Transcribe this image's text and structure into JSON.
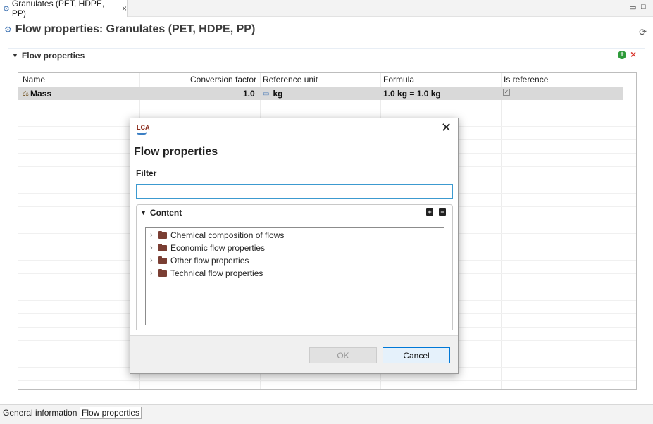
{
  "editor_tab": {
    "icon": "gear-icon",
    "label": "Granulates (PET, HDPE, PP)",
    "close": "×"
  },
  "window_controls": {
    "minimize": "▭",
    "maximize": "□"
  },
  "form": {
    "title": "Flow properties: Granulates (PET, HDPE, PP)",
    "refresh_icon": "⟳"
  },
  "section": {
    "title": "Flow properties",
    "add_icon": "+",
    "remove_icon": "×"
  },
  "table": {
    "columns": [
      "Name",
      "Conversion factor",
      "Reference unit",
      "Formula",
      "Is reference"
    ],
    "rows": [
      {
        "name": "Mass",
        "conversion_factor": "1.0",
        "reference_unit": "kg",
        "formula": "1.0 kg = 1.0 kg",
        "is_reference": true
      }
    ]
  },
  "bottom_tabs": [
    "General information",
    "Flow properties"
  ],
  "dialog": {
    "logo": "LCA",
    "title": "Flow properties",
    "filter_label": "Filter",
    "filter_value": "",
    "content_label": "Content",
    "tree_items": [
      "Chemical composition of flows",
      "Economic flow properties",
      "Other flow properties",
      "Technical flow properties"
    ],
    "ok_label": "OK",
    "cancel_label": "Cancel"
  },
  "colors": {
    "accent_blue": "#0078d7",
    "folder_brown": "#7a3e33",
    "add_green": "#2e9b3a",
    "remove_red": "#d9342b"
  }
}
